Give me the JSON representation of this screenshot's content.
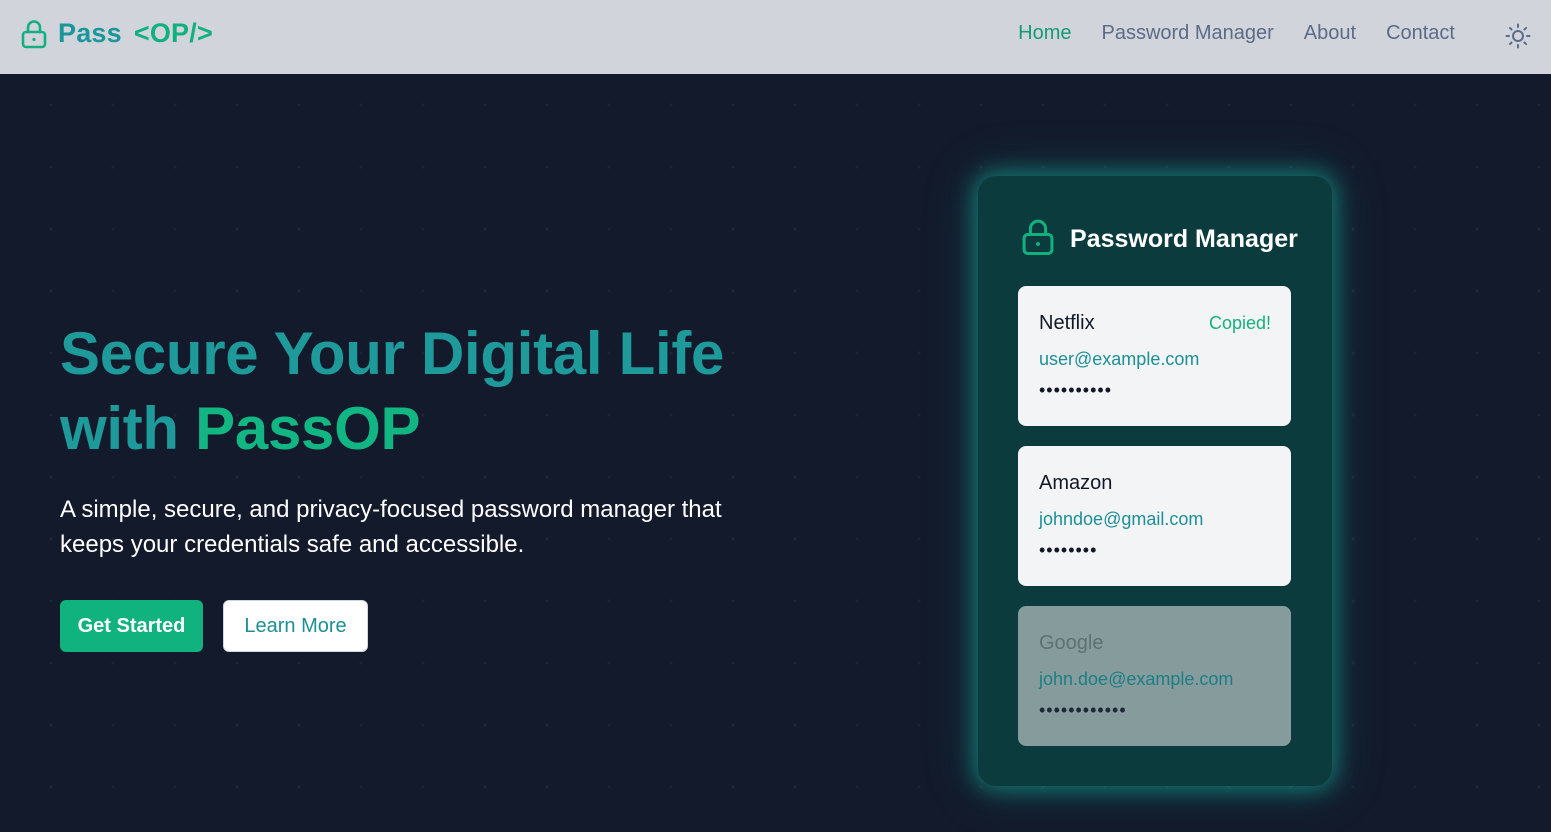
{
  "navbar": {
    "brand_pass": "Pass",
    "brand_op": "<OP/>",
    "links": [
      {
        "label": "Home",
        "active": true
      },
      {
        "label": "Password Manager",
        "active": false
      },
      {
        "label": "About",
        "active": false
      },
      {
        "label": "Contact",
        "active": false
      }
    ]
  },
  "hero": {
    "title_line1": "Secure Your Digital Life",
    "title_with": "with ",
    "title_accent": "PassOP",
    "subtitle": "A simple, secure, and privacy-focused password manager that keeps your credentials safe and accessible.",
    "primary_button": "Get Started",
    "secondary_button": "Learn More"
  },
  "card": {
    "title": "Password Manager",
    "entries": [
      {
        "name": "Netflix",
        "email": "user@example.com",
        "password": "••••••••••",
        "status": "Copied!"
      },
      {
        "name": "Amazon",
        "email": "johndoe@gmail.com",
        "password": "••••••••",
        "status": ""
      },
      {
        "name": "Google",
        "email": "john.doe@example.com",
        "password": "••••••••••••",
        "status": ""
      }
    ]
  },
  "icons": {
    "brand": "lock-icon",
    "theme": "sun-icon",
    "card": "lock-icon"
  },
  "colors": {
    "accent": "#10b37e",
    "teal": "#1e9a9b",
    "background": "#131a2b",
    "navbar": "#d1d5db",
    "card": "#0b3b3d"
  }
}
